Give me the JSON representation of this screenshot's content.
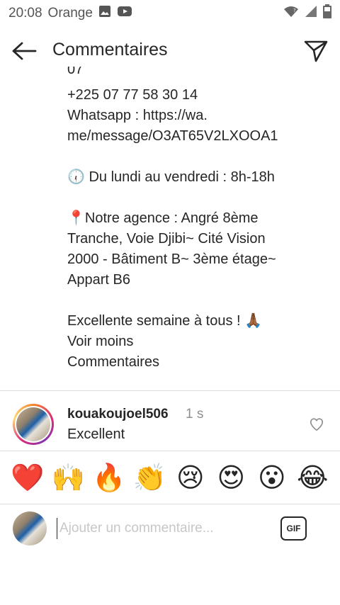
{
  "status_bar": {
    "time": "20:08",
    "carrier": "Orange"
  },
  "header": {
    "title": "Commentaires"
  },
  "caption": {
    "cut_line": "07",
    "phone": "+225 07 77 58 30 14",
    "whatsapp_line1": "Whatsapp : https://wa.",
    "whatsapp_line2": "me/message/O3AT65V2LXOOA1",
    "hours_icon": "🕡",
    "hours": " Du lundi au vendredi : 8h-18h",
    "agency_icon": "📍",
    "agency_line1": "Notre agence : Angré 8ème",
    "agency_line2": "Tranche, Voie Djibi~ Cité Vision",
    "agency_line3": "2000 - Bâtiment B~ 3ème étage~",
    "agency_line4": "Appart B6",
    "closing": "Excellente semaine à tous ! ",
    "closing_icon": "🙏🏾",
    "see_less": "Voir moins",
    "comments_link": "Commentaires"
  },
  "comment": {
    "username": "kouakoujoel506",
    "time": "1 s",
    "text": "Excellent"
  },
  "reactions": [
    "❤️",
    "🙌",
    "🔥",
    "👏",
    "😢",
    "😍",
    "😮",
    "😂"
  ],
  "input": {
    "placeholder": "Ajouter un commentaire...",
    "gif_label": "GIF"
  }
}
